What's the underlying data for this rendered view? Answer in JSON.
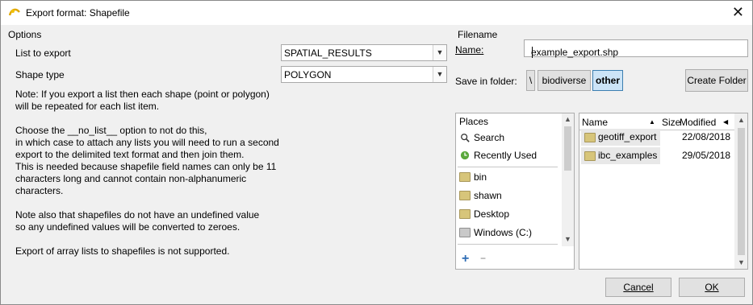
{
  "window": {
    "title": "Export format: Shapefile",
    "close_glyph": "✕"
  },
  "options": {
    "heading": "Options",
    "list_label": "List to export",
    "list_value": "SPATIAL_RESULTS",
    "shape_label": "Shape type",
    "shape_value": "POLYGON",
    "notes": [
      "Note: If you export a list then each shape (point or polygon)\nwill be repeated for each list item.",
      "Choose the __no_list__ option to not do this,\nin which case to attach any lists you will need to run a second\nexport to the delimited text format and then join them.\nThis is needed because shapefile field names can only be 11\ncharacters long and cannot contain non-alphanumeric\ncharacters.",
      "Note also that shapefiles do not have an undefined value\nso any undefined values will be converted to zeroes.",
      "Export of array lists to shapefiles is not supported."
    ]
  },
  "file": {
    "heading": "Filename",
    "name_label": "Name:",
    "name_value": "example_export.shp",
    "save_label": "Save in folder:",
    "crumb_back": "\\",
    "crumbs": [
      "biodiverse",
      "other"
    ],
    "create_folder": "Create Folder"
  },
  "places": {
    "heading": "Places",
    "items": [
      {
        "label": "Search",
        "icon": "search-icon"
      },
      {
        "label": "Recently Used",
        "icon": "recent-icon"
      },
      {
        "label": "bin",
        "icon": "folder-icon"
      },
      {
        "label": "shawn",
        "icon": "folder-icon"
      },
      {
        "label": "Desktop",
        "icon": "folder-icon"
      },
      {
        "label": "Windows (C:)",
        "icon": "drive-icon"
      }
    ],
    "add_glyph": "+",
    "remove_glyph": "−"
  },
  "files": {
    "columns": {
      "name": "Name",
      "size": "Size",
      "modified": "Modified"
    },
    "rows": [
      {
        "name": "geotiff_export",
        "modified": "22/08/2018"
      },
      {
        "name": "ibc_examples",
        "modified": "29/05/2018"
      }
    ]
  },
  "buttons": {
    "cancel": "Cancel",
    "ok": "OK"
  }
}
